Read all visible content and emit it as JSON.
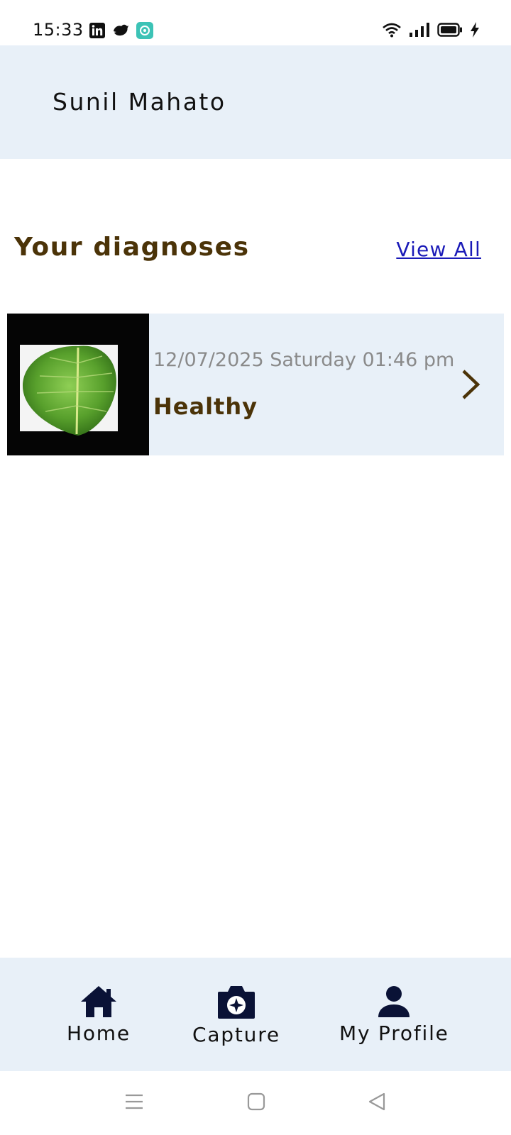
{
  "status_bar": {
    "time": "15:33",
    "app_icons": [
      "linkedin-icon",
      "bird-app-icon",
      "chat-app-icon"
    ],
    "indicators": [
      "wifi-icon",
      "signal-icon",
      "battery-icon",
      "charging-icon"
    ]
  },
  "header": {
    "user_name": "Sunil Mahato"
  },
  "diagnoses": {
    "title": "Your diagnoses",
    "view_all_label": "View All",
    "items": [
      {
        "date": "12/07/2025 Saturday 01:46 pm",
        "status": "Healthy",
        "thumbnail_icon": "leaf-image"
      }
    ]
  },
  "bottom_nav": {
    "items": [
      {
        "label": "Home",
        "icon": "home-icon"
      },
      {
        "label": "Capture",
        "icon": "camera-icon"
      },
      {
        "label": "My Profile",
        "icon": "person-icon"
      }
    ]
  },
  "system_nav": [
    "menu-icon",
    "home-square-icon",
    "back-triangle-icon"
  ],
  "colors": {
    "header_bg": "#e8f0f8",
    "title_brown": "#4b3308",
    "link_blue": "#1a1ab8",
    "nav_icon": "#0a1236",
    "date_gray": "#8a8a8a"
  }
}
